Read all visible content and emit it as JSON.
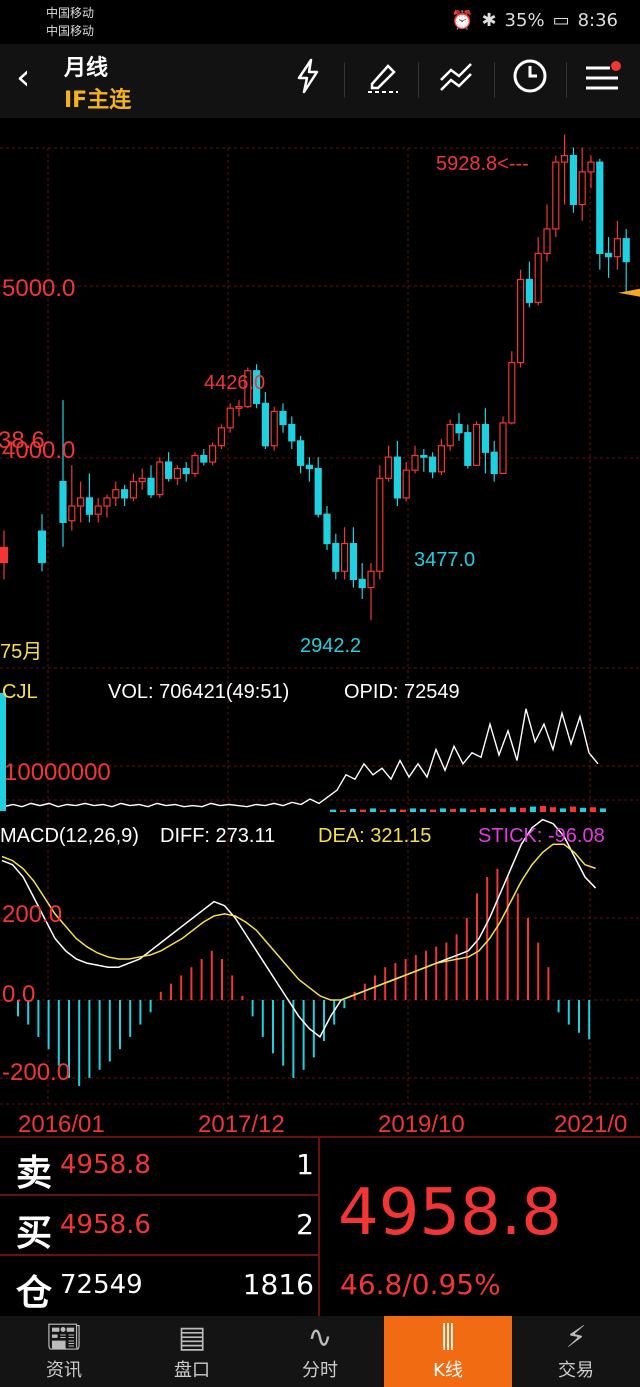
{
  "status": {
    "carrier1": "中国移动",
    "carrier2": "中国移动",
    "battery": "35%",
    "time": "8:36"
  },
  "header": {
    "period": "月线",
    "contract": "IF主连"
  },
  "icons": {
    "back": "back-arrow-icon",
    "flash": "lightning-icon",
    "draw": "pencil-icon",
    "indicator": "trend-lines-icon",
    "clock": "clock-icon",
    "menu": "menu-icon"
  },
  "kline": {
    "labels": {
      "high": "5928.8<---",
      "y5000": "5000.0",
      "y4000": "4000.0",
      "y4426": "4426.0",
      "low2942": "2942.2",
      "low3477": "3477.0",
      "left_partial": "38.6",
      "left_bottom": "75月"
    },
    "x_dates": [
      "2016/01",
      "2017/12",
      "2019/10",
      "2021/0"
    ],
    "candles": [
      [
        3800,
        3550,
        4300,
        3400
      ],
      [
        3560,
        3650,
        3900,
        3500
      ],
      [
        3650,
        3700,
        3800,
        3550
      ],
      [
        3700,
        3600,
        3850,
        3550
      ],
      [
        3600,
        3650,
        3700,
        3550
      ],
      [
        3650,
        3700,
        3720,
        3580
      ],
      [
        3700,
        3750,
        3800,
        3650
      ],
      [
        3750,
        3700,
        3780,
        3650
      ],
      [
        3700,
        3800,
        3850,
        3680
      ],
      [
        3800,
        3820,
        3880,
        3750
      ],
      [
        3820,
        3720,
        3900,
        3700
      ],
      [
        3720,
        3920,
        3950,
        3700
      ],
      [
        3920,
        3820,
        3980,
        3800
      ],
      [
        3820,
        3880,
        3900,
        3780
      ],
      [
        3880,
        3850,
        3920,
        3800
      ],
      [
        3850,
        3960,
        3980,
        3830
      ],
      [
        3960,
        3920,
        4000,
        3900
      ],
      [
        3920,
        4020,
        4040,
        3900
      ],
      [
        4020,
        4130,
        4150,
        4000
      ],
      [
        4130,
        4250,
        4280,
        4100
      ],
      [
        4250,
        4260,
        4300,
        4200
      ],
      [
        4260,
        4480,
        4500,
        4250
      ],
      [
        4480,
        4280,
        4520,
        4250
      ],
      [
        4280,
        4020,
        4350,
        4000
      ],
      [
        4020,
        4230,
        4260,
        3990
      ],
      [
        4230,
        4150,
        4280,
        4100
      ],
      [
        4150,
        4050,
        4200,
        4000
      ],
      [
        4050,
        3900,
        4080,
        3850
      ],
      [
        3900,
        3880,
        3950,
        3800
      ],
      [
        3880,
        3600,
        3950,
        3580
      ],
      [
        3600,
        3420,
        3650,
        3380
      ],
      [
        3420,
        3250,
        3480,
        3200
      ],
      [
        3250,
        3420,
        3520,
        3200
      ],
      [
        3420,
        3200,
        3520,
        3150
      ],
      [
        3200,
        3150,
        3300,
        3080
      ],
      [
        3150,
        3250,
        3300,
        2950
      ],
      [
        3250,
        3820,
        3900,
        3200
      ],
      [
        3820,
        3950,
        4020,
        3800
      ],
      [
        3950,
        3700,
        4050,
        3650
      ],
      [
        3700,
        3870,
        3920,
        3680
      ],
      [
        3870,
        3960,
        4020,
        3850
      ],
      [
        3960,
        3950,
        4000,
        3860
      ],
      [
        3950,
        3860,
        3980,
        3820
      ],
      [
        3860,
        4020,
        4060,
        3840
      ],
      [
        4020,
        4150,
        4180,
        3990
      ],
      [
        4150,
        4100,
        4220,
        4050
      ],
      [
        4100,
        3900,
        4150,
        3880
      ],
      [
        3900,
        4150,
        4170,
        3900
      ],
      [
        4150,
        3980,
        4250,
        3850
      ],
      [
        3980,
        3850,
        4050,
        3800
      ],
      [
        3850,
        4160,
        4200,
        3850
      ],
      [
        4160,
        4530,
        4600,
        4150
      ],
      [
        4530,
        5040,
        5100,
        4500
      ],
      [
        5040,
        4900,
        5150,
        4870
      ],
      [
        4900,
        5200,
        5300,
        4880
      ],
      [
        5200,
        5350,
        5500,
        5150
      ],
      [
        5350,
        5760,
        5800,
        5300
      ],
      [
        5760,
        5800,
        5929,
        5500
      ],
      [
        5800,
        5500,
        5850,
        5450
      ],
      [
        5500,
        5700,
        5850,
        5400
      ],
      [
        5700,
        5760,
        5800,
        5600
      ],
      [
        5760,
        5200,
        5780,
        5100
      ],
      [
        5200,
        5180,
        5300,
        5050
      ],
      [
        5180,
        5290,
        5400,
        5100
      ],
      [
        5290,
        5150,
        5350,
        4959
      ]
    ],
    "left_bars": [
      {
        "color": "up",
        "open": 3400,
        "close": 3300,
        "high": 3500,
        "low": 3200
      },
      {
        "color": "down",
        "open": 3500,
        "close": 3300,
        "high": 3600,
        "low": 3250
      }
    ],
    "right_marker": {
      "price": 4958.8,
      "color": "#f5a623"
    }
  },
  "volume": {
    "title": "CJL",
    "vol_label": "VOL: 706421(49:51)",
    "opid_label": "OPID: 72549",
    "scale_label": "10000000",
    "oi_line": [
      0.03,
      0.05,
      0.03,
      0.06,
      0.04,
      0.06,
      0.03,
      0.05,
      0.04,
      0.06,
      0.04,
      0.05,
      0.03,
      0.06,
      0.04,
      0.05,
      0.03,
      0.06,
      0.04,
      0.05,
      0.03,
      0.04,
      0.03,
      0.06,
      0.04,
      0.05,
      0.04,
      0.03,
      0.05,
      0.04,
      0.06,
      0.04,
      0.07,
      0.05,
      0.1,
      0.06,
      0.12,
      0.18,
      0.32,
      0.28,
      0.42,
      0.32,
      0.38,
      0.28,
      0.45,
      0.3,
      0.42,
      0.3,
      0.55,
      0.36,
      0.58,
      0.42,
      0.52,
      0.48,
      0.78,
      0.5,
      0.72,
      0.45,
      0.92,
      0.62,
      0.78,
      0.55,
      0.88,
      0.6,
      0.85,
      0.52,
      0.42
    ],
    "vol_bars": [
      0.04,
      0.03,
      0.05,
      0.04,
      0.06,
      0.03,
      0.05,
      0.04,
      0.06,
      0.05,
      0.04,
      0.06,
      0.05,
      0.06,
      0.04,
      0.07,
      0.05,
      0.06,
      0.08,
      0.07,
      0.09,
      0.1,
      0.08,
      0.06,
      0.09,
      0.07,
      0.08,
      0.06
    ],
    "vol_colors": [
      "down",
      "up",
      "down",
      "up",
      "down",
      "up",
      "down",
      "up",
      "down",
      "down",
      "up",
      "down",
      "up",
      "down",
      "up",
      "up",
      "down",
      "up",
      "down",
      "up",
      "down",
      "up",
      "up",
      "down",
      "up",
      "down",
      "up",
      "down"
    ]
  },
  "macd": {
    "title_label": "MACD(12,26,9)",
    "diff_label": "DIFF: 273.11",
    "dea_label": "DEA: 321.15",
    "stick_label": "STICK: -96.08",
    "y_labels": [
      "200.0",
      "0.0",
      "-200.0"
    ],
    "diff": [
      340,
      330,
      300,
      250,
      200,
      150,
      120,
      100,
      90,
      85,
      80,
      80,
      90,
      100,
      120,
      140,
      160,
      180,
      200,
      220,
      240,
      230,
      200,
      160,
      120,
      80,
      40,
      0,
      -40,
      -70,
      -90,
      -40,
      0,
      10,
      20,
      30,
      40,
      50,
      60,
      70,
      80,
      90,
      100,
      110,
      120,
      150,
      200,
      260,
      320,
      380,
      420,
      440,
      430,
      400,
      350,
      300,
      273
    ],
    "dea": [
      350,
      340,
      320,
      290,
      250,
      210,
      180,
      150,
      130,
      115,
      105,
      100,
      100,
      105,
      110,
      120,
      135,
      150,
      170,
      190,
      205,
      210,
      205,
      190,
      170,
      140,
      110,
      80,
      50,
      30,
      10,
      0,
      0,
      10,
      20,
      30,
      40,
      50,
      60,
      70,
      80,
      90,
      95,
      100,
      105,
      120,
      150,
      190,
      240,
      290,
      330,
      360,
      380,
      380,
      360,
      330,
      321
    ],
    "stick": [
      -40,
      -60,
      -90,
      -120,
      -160,
      -190,
      -210,
      -190,
      -170,
      -150,
      -120,
      -90,
      -60,
      -30,
      20,
      40,
      60,
      80,
      100,
      120,
      100,
      60,
      10,
      -40,
      -90,
      -130,
      -160,
      -190,
      -170,
      -140,
      -100,
      -60,
      -20,
      20,
      40,
      60,
      80,
      90,
      100,
      110,
      120,
      130,
      140,
      160,
      200,
      260,
      300,
      320,
      300,
      260,
      200,
      140,
      80,
      -30,
      -60,
      -80,
      -96
    ]
  },
  "quote": {
    "sell_label": "卖",
    "sell_price": "4958.8",
    "sell_vol": "1",
    "buy_label": "买",
    "buy_price": "4958.6",
    "buy_vol": "2",
    "oi_label": "仓",
    "oi_value": "72549",
    "oi_change": "1816",
    "last_price": "4958.8",
    "change": "46.8/0.95%"
  },
  "tabs": [
    {
      "label": "资讯",
      "icon": "news-icon"
    },
    {
      "label": "盘口",
      "icon": "orderbook-icon"
    },
    {
      "label": "分时",
      "icon": "intraday-icon"
    },
    {
      "label": "K线",
      "icon": "candlestick-icon"
    },
    {
      "label": "交易",
      "icon": "trade-icon"
    }
  ],
  "colors": {
    "up": "#f23535",
    "down": "#1fd1e0",
    "grid": "#6a1010",
    "yellow": "#f5e04a",
    "magenta": "#e33be3",
    "accent": "#f16b12"
  }
}
